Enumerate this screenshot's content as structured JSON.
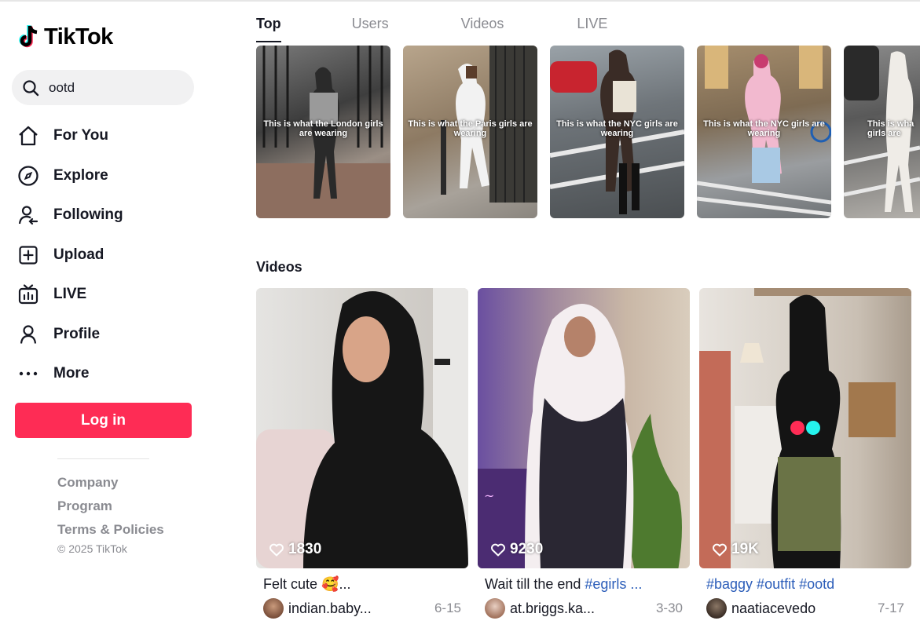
{
  "brand": {
    "name": "TikTok"
  },
  "search": {
    "value": "ootd",
    "icon": "search-icon"
  },
  "nav": [
    {
      "label": "For You",
      "icon": "home-icon"
    },
    {
      "label": "Explore",
      "icon": "compass-icon"
    },
    {
      "label": "Following",
      "icon": "following-icon"
    },
    {
      "label": "Upload",
      "icon": "upload-icon"
    },
    {
      "label": "LIVE",
      "icon": "live-tv-icon"
    },
    {
      "label": "Profile",
      "icon": "profile-icon"
    },
    {
      "label": "More",
      "icon": "more-dots-icon"
    }
  ],
  "login": {
    "label": "Log in"
  },
  "footer": {
    "links": [
      "Company",
      "Program",
      "Terms & Policies"
    ],
    "copyright": "© 2025 TikTok"
  },
  "tabs": [
    "Top",
    "Users",
    "Videos",
    "LIVE"
  ],
  "active_tab": "Top",
  "top_videos": [
    {
      "caption": "This is what the London girls are wearing"
    },
    {
      "caption": "This is what the Paris girls are wearing"
    },
    {
      "caption": "This is what the NYC girls are wearing"
    },
    {
      "caption": "This is what the NYC girls are wearing"
    },
    {
      "caption": "This is wha girls are"
    }
  ],
  "videos_title": "Videos",
  "videos": [
    {
      "likes": "1830",
      "desc_text": "Felt cute 🥰...",
      "desc_tags": "",
      "user": "indian.baby...",
      "date": "6-15"
    },
    {
      "likes": "9230",
      "desc_text": "Wait till the end ",
      "desc_tags": "#egirls ...",
      "user": "at.briggs.ka...",
      "date": "3-30"
    },
    {
      "likes": "19K",
      "desc_text": "",
      "desc_tags": "#baggy #outfit #ootd",
      "user": "naatiacevedo",
      "date": "7-17"
    }
  ],
  "colors": {
    "accent": "#fe2c55",
    "hashtag": "#2b5db9"
  }
}
